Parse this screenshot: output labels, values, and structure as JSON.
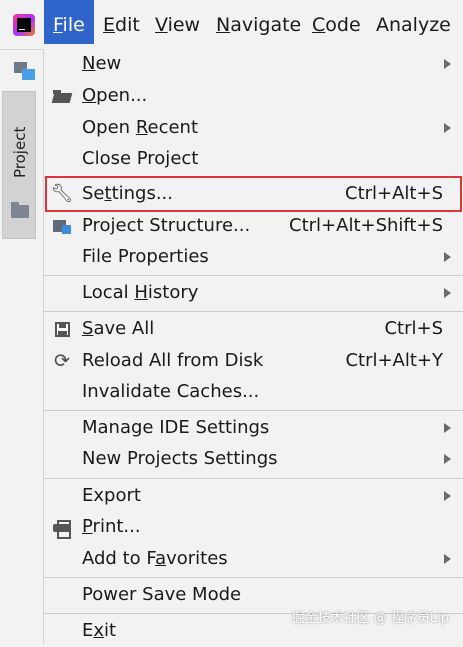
{
  "menubar": {
    "items": [
      {
        "label": "File",
        "mnemonic": "F",
        "rest": "ile"
      },
      {
        "label": "Edit",
        "mnemonic": "E",
        "rest": "dit"
      },
      {
        "label": "View",
        "mnemonic": "V",
        "rest": "iew"
      },
      {
        "label": "Navigate",
        "mnemonic": "N",
        "rest": "avigate"
      },
      {
        "label": "Code",
        "mnemonic": "C",
        "rest": "ode"
      },
      {
        "label": "Analyze",
        "mnemonic": "",
        "rest": "Analyze"
      }
    ],
    "active_color": "#2f65ca"
  },
  "toolstrip": {
    "project_tab_label": "Project"
  },
  "file_menu": {
    "new": {
      "pre": "",
      "mn": "N",
      "post": "ew"
    },
    "open": {
      "pre": "",
      "mn": "O",
      "post": "pen..."
    },
    "open_recent": {
      "pre": "Open ",
      "mn": "R",
      "post": "ecent"
    },
    "close_project": {
      "label": "Close Project"
    },
    "settings": {
      "pre": "Se",
      "mn": "t",
      "post": "tings...",
      "shortcut": "Ctrl+Alt+S"
    },
    "project_structure": {
      "label": "Project Structure...",
      "shortcut": "Ctrl+Alt+Shift+S"
    },
    "file_properties": {
      "label": "File Properties"
    },
    "local_history": {
      "pre": "Local ",
      "mn": "H",
      "post": "istory"
    },
    "save_all": {
      "pre": "",
      "mn": "S",
      "post": "ave All",
      "shortcut": "Ctrl+S"
    },
    "reload": {
      "label": "Reload All from Disk",
      "shortcut": "Ctrl+Alt+Y"
    },
    "invalidate": {
      "label": "Invalidate Caches..."
    },
    "manage_ide": {
      "label": "Manage IDE Settings"
    },
    "new_projects_settings": {
      "label": "New Projects Settings"
    },
    "export": {
      "label": "Export"
    },
    "print": {
      "pre": "",
      "mn": "P",
      "post": "rint..."
    },
    "favorites": {
      "pre": "Add to F",
      "mn": "a",
      "post": "vorites"
    },
    "power_save": {
      "label": "Power Save Mode"
    },
    "exit": {
      "pre": "E",
      "mn": "x",
      "post": "it"
    }
  },
  "highlight_color": "#d9363e",
  "watermark": "掘金技术社区 @ 程序员Lip"
}
